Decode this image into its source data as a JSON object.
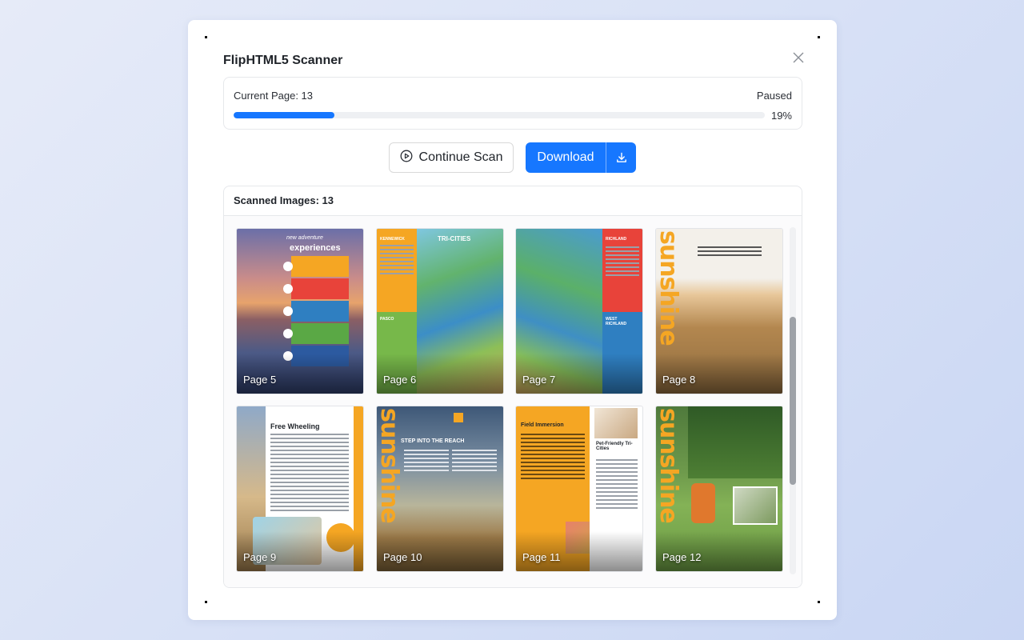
{
  "dialog": {
    "title": "FlipHTML5 Scanner",
    "close_icon": "close-icon"
  },
  "progress": {
    "current_page_label": "Current Page: 13",
    "status": "Paused",
    "percent": 19,
    "percent_label": "19%",
    "bar_color": "#1677ff"
  },
  "actions": {
    "continue_label": "Continue Scan",
    "continue_icon": "play-circle-icon",
    "download_label": "Download",
    "download_icon": "download-icon",
    "accent": "#1677ff"
  },
  "images": {
    "header": "Scanned Images: 13",
    "thumbnails": [
      {
        "label": "Page 5",
        "heading": "experiences",
        "script": "new adventure"
      },
      {
        "label": "Page 6",
        "tags": [
          "KENNEWICK",
          "PASCO"
        ],
        "logo": "TRI-CITIES"
      },
      {
        "label": "Page 7",
        "tags": [
          "RICHLAND",
          "WEST RICHLAND"
        ]
      },
      {
        "label": "Page 8",
        "vertical": "sunshine"
      },
      {
        "label": "Page 9",
        "heading": "Free Wheeling"
      },
      {
        "label": "Page 10",
        "heading": "STEP INTO THE REACH",
        "vertical": "sunshine"
      },
      {
        "label": "Page 11",
        "heading": "Field Immersion",
        "subheading": "Pet-Friendly Tri-Cities"
      },
      {
        "label": "Page 12",
        "vertical": "sunshine"
      }
    ]
  }
}
